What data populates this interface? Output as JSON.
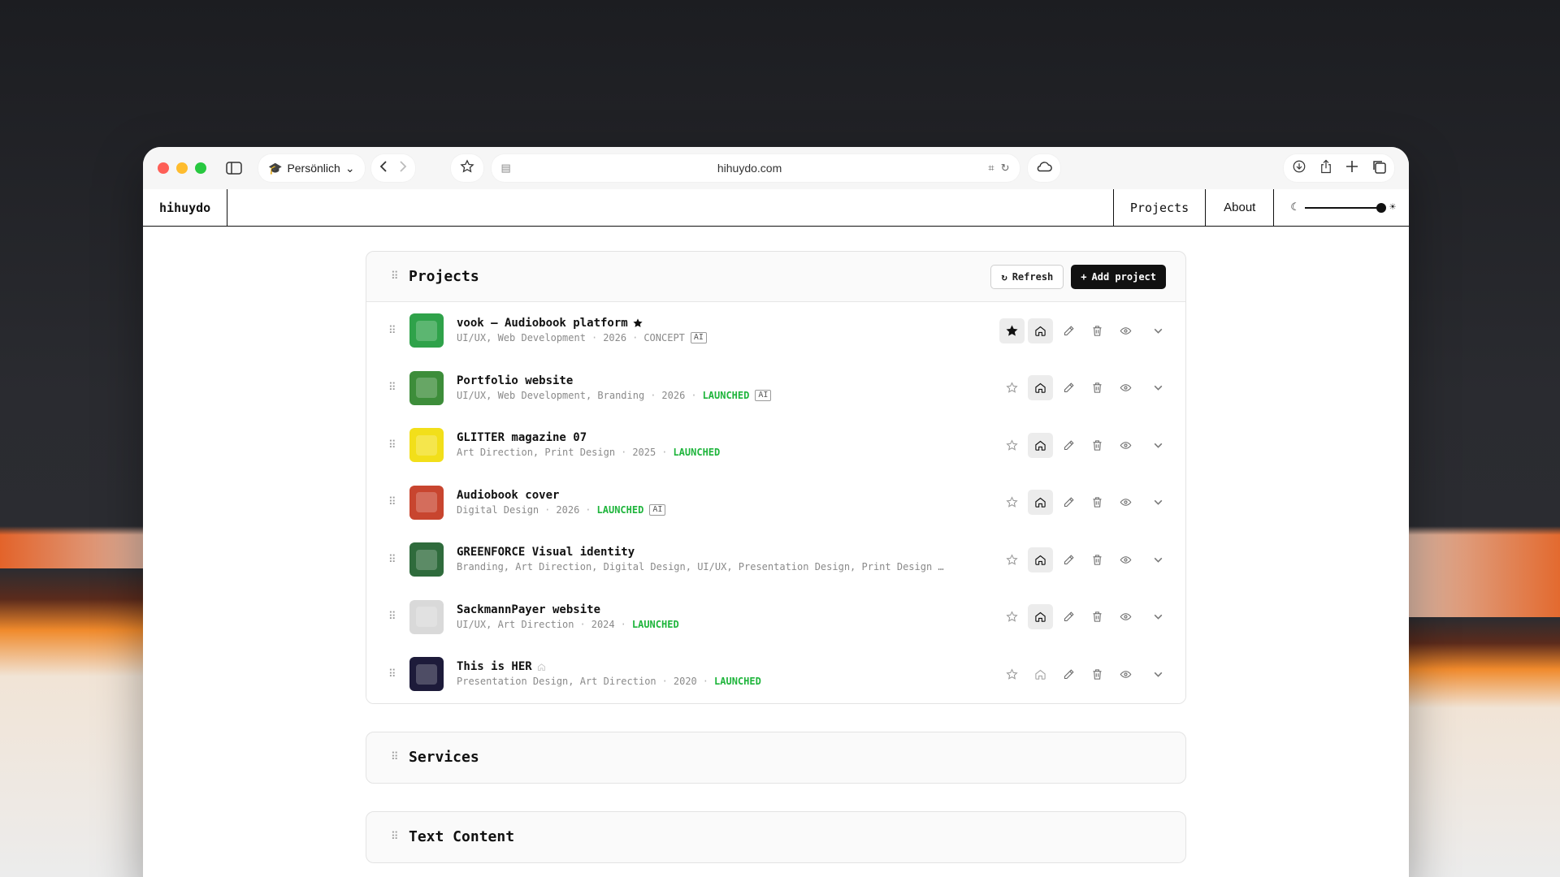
{
  "browser": {
    "profile": "Persönlich",
    "url": "hihuydo.com"
  },
  "site": {
    "logo": "hihuydo",
    "nav": {
      "projects": "Projects",
      "about": "About"
    },
    "theme_level": 1.0
  },
  "projects_card": {
    "title": "Projects",
    "refresh_label": "Refresh",
    "add_label": "Add project",
    "items": [
      {
        "title": "vook – Audiobook platform",
        "featured": true,
        "tags": "UI/UX, Web Development",
        "year": "2026",
        "status": "CONCEPT",
        "status_kind": "concept",
        "ai": "AI",
        "home_on": true,
        "star_on": true,
        "thumb_color": "#2fa24a"
      },
      {
        "title": "Portfolio website",
        "featured": false,
        "tags": "UI/UX, Web Development, Branding",
        "year": "2026",
        "status": "LAUNCHED",
        "status_kind": "launched",
        "ai": "AI",
        "home_on": true,
        "star_on": false,
        "thumb_color": "#3d8d3a"
      },
      {
        "title": "GLITTER magazine 07",
        "featured": false,
        "tags": "Art Direction, Print Design",
        "year": "2025",
        "status": "LAUNCHED",
        "status_kind": "launched",
        "ai": "",
        "home_on": true,
        "star_on": false,
        "thumb_color": "#f2df1a"
      },
      {
        "title": "Audiobook cover",
        "featured": false,
        "tags": "Digital Design",
        "year": "2026",
        "status": "LAUNCHED",
        "status_kind": "launched",
        "ai": "AI",
        "home_on": true,
        "star_on": false,
        "thumb_color": "#c8452f"
      },
      {
        "title": "GREENFORCE Visual identity",
        "featured": false,
        "tags": "Branding, Art Direction, Digital Design, UI/UX, Presentation Design, Print Design …",
        "year": "",
        "status": "",
        "status_kind": "",
        "ai": "",
        "home_on": true,
        "star_on": false,
        "thumb_color": "#2f6b3c"
      },
      {
        "title": "SackmannPayer website",
        "featured": false,
        "tags": "UI/UX, Art Direction",
        "year": "2024",
        "status": "LAUNCHED",
        "status_kind": "launched",
        "ai": "",
        "home_on": true,
        "star_on": false,
        "thumb_color": "#d9d9d9"
      },
      {
        "title": "This is HER",
        "featured": false,
        "home_mark": true,
        "tags": "Presentation Design, Art Direction",
        "year": "2020",
        "status": "LAUNCHED",
        "status_kind": "launched",
        "ai": "",
        "home_on": false,
        "star_on": false,
        "thumb_color": "#1d1b3a"
      }
    ]
  },
  "services_card": {
    "title": "Services"
  },
  "text_card": {
    "title": "Text Content"
  }
}
